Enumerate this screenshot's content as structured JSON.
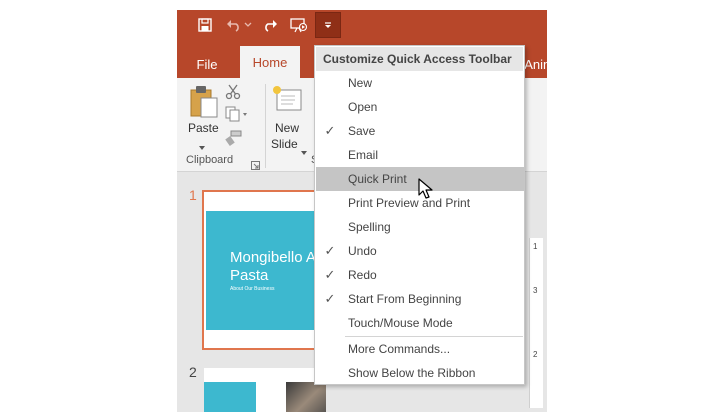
{
  "qat": {
    "icons": [
      "save-icon",
      "undo-icon",
      "redo-icon",
      "start-from-beginning-icon",
      "customize-qat-dropdown-icon"
    ]
  },
  "tabs": {
    "file": "File",
    "home": "Home",
    "animations": "Anim"
  },
  "ribbon": {
    "paste_label": "Paste",
    "new_slide_label_1": "New",
    "new_slide_label_2": "Slide",
    "clipboard_group": "Clipboard",
    "slides_group_partial": "S"
  },
  "slides": {
    "slide1_number": "1",
    "slide1_title": "Mongibello A\nPasta",
    "slide1_subtitle": "About Our Business",
    "slide2_number": "2"
  },
  "ruler": {
    "marks": [
      "1",
      "3",
      "2"
    ]
  },
  "menu": {
    "header": "Customize Quick Access Toolbar",
    "items": [
      {
        "label": "New",
        "checked": false
      },
      {
        "label": "Open",
        "checked": false
      },
      {
        "label": "Save",
        "checked": true
      },
      {
        "label": "Email",
        "checked": false
      },
      {
        "label": "Quick Print",
        "checked": false,
        "highlighted": true
      },
      {
        "label": "Print Preview and Print",
        "checked": false
      },
      {
        "label": "Spelling",
        "checked": false
      },
      {
        "label": "Undo",
        "checked": true
      },
      {
        "label": "Redo",
        "checked": true
      },
      {
        "label": "Start From Beginning",
        "checked": true
      },
      {
        "label": "Touch/Mouse Mode",
        "checked": false
      }
    ],
    "more_commands": "More Commands...",
    "show_below": "Show Below the Ribbon",
    "checkmark": "✓"
  },
  "colors": {
    "accent": "#b7472a",
    "slide_teal": "#3db8cf",
    "selected_border": "#e0764d",
    "menu_hover": "#c5c5c5"
  }
}
